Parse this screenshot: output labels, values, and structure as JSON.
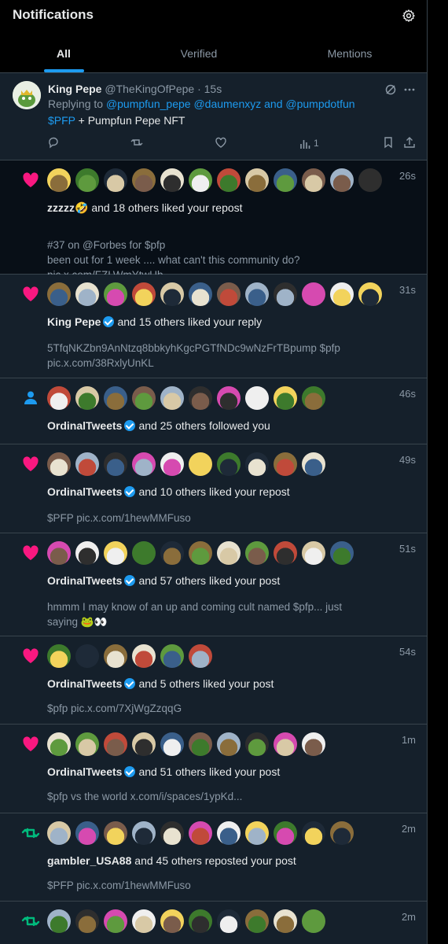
{
  "header": {
    "title": "Notifications",
    "tabs": [
      {
        "label": "All"
      },
      {
        "label": "Verified"
      },
      {
        "label": "Mentions"
      }
    ]
  },
  "tweet": {
    "name": "King Pepe",
    "handle_time": "@TheKingOfPepe · 15s",
    "replying_to": "Replying to",
    "mentions": "@pumpfun_pepe @daumenxyz and @pumpdotfun",
    "cashtag": "$PFP",
    "text": "+ Pumpfun Pepe NFT",
    "views": "1",
    "icons": [
      "reply-icon",
      "retweet-icon",
      "like-icon",
      "views-icon",
      "bookmark-icon",
      "share-icon",
      "grok-icon",
      "more-icon"
    ]
  },
  "notifications": [
    {
      "kind": "like",
      "time": "26s",
      "actor": "zzzzz🤣",
      "verified": false,
      "action": "and 18 others liked your repost",
      "preview": "#37 on @Forbes for $pfp\nbeen out for 1 week .... what can't this community do?\npic.x.com/FZLWmYtwUb"
    },
    {
      "kind": "like",
      "time": "31s",
      "actor": "King Pepe",
      "verified": true,
      "action": "and 15 others liked your reply",
      "preview": "5TfqNKZbn9AnNtzq8bbkyhKgcPGTfNDc9wNzFrTBpump  $pfp\npic.x.com/38RxlyUnKL"
    },
    {
      "kind": "follow",
      "time": "46s",
      "actor": "OrdinalTweets",
      "verified": true,
      "action": "and 25 others followed you",
      "preview": ""
    },
    {
      "kind": "like",
      "time": "49s",
      "actor": "OrdinalTweets",
      "verified": true,
      "action": "and 10 others liked your repost",
      "preview": "$PFP pic.x.com/1hewMMFuso"
    },
    {
      "kind": "like",
      "time": "51s",
      "actor": "OrdinalTweets",
      "verified": true,
      "action": "and 57 others liked your post",
      "preview": "hmmm I may know of an up and coming cult named $pfp... just\nsaying 🐸👀"
    },
    {
      "kind": "like",
      "time": "54s",
      "actor": "OrdinalTweets",
      "verified": true,
      "action": "and 5 others liked your post",
      "preview": "$pfp pic.x.com/7XjWgZzqqG"
    },
    {
      "kind": "like",
      "time": "1m",
      "actor": "OrdinalTweets",
      "verified": true,
      "action": "and 51 others liked your post",
      "preview": "$pfp vs the world  x.com/i/spaces/1ypKd..."
    },
    {
      "kind": "repost",
      "time": "2m",
      "actor": "gambler_USA88",
      "verified": false,
      "action": "and 45 others reposted your post",
      "preview": "$PFP pic.x.com/1hewMMFuso"
    },
    {
      "kind": "repost",
      "time": "2m",
      "actor": "",
      "verified": false,
      "action": "",
      "preview": ""
    }
  ],
  "colors": {
    "accent": "#1d9bf0",
    "like": "#f91880",
    "repost": "#00ba7c",
    "background": "#15202b",
    "muted": "#8b98a5"
  }
}
